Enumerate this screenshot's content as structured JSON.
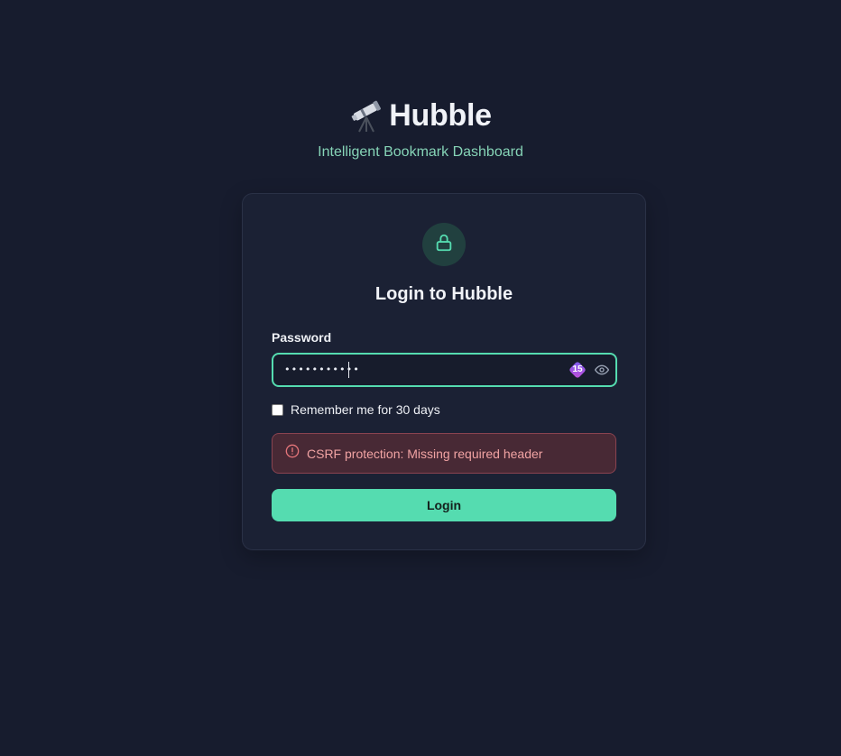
{
  "brand": {
    "icon": "telescope-icon",
    "title": "Hubble",
    "tagline": "Intelligent Bookmark Dashboard"
  },
  "login_card": {
    "icon": "lock-icon",
    "title": "Login to Hubble",
    "password_label": "Password",
    "password_value": "•••••••••••",
    "password_manager_badge": "15",
    "reveal_icon": "eye-icon",
    "remember_label": "Remember me for 30 days",
    "remember_checked": false,
    "error_icon": "alert-circle-icon",
    "error_message": "CSRF protection: Missing required header",
    "submit_label": "Login"
  },
  "colors": {
    "background": "#171c2e",
    "card": "#1b2134",
    "accent": "#55dcb0",
    "tagline": "#86d4b7",
    "error_bg": "#482935",
    "error_text": "#f1a3a3"
  }
}
